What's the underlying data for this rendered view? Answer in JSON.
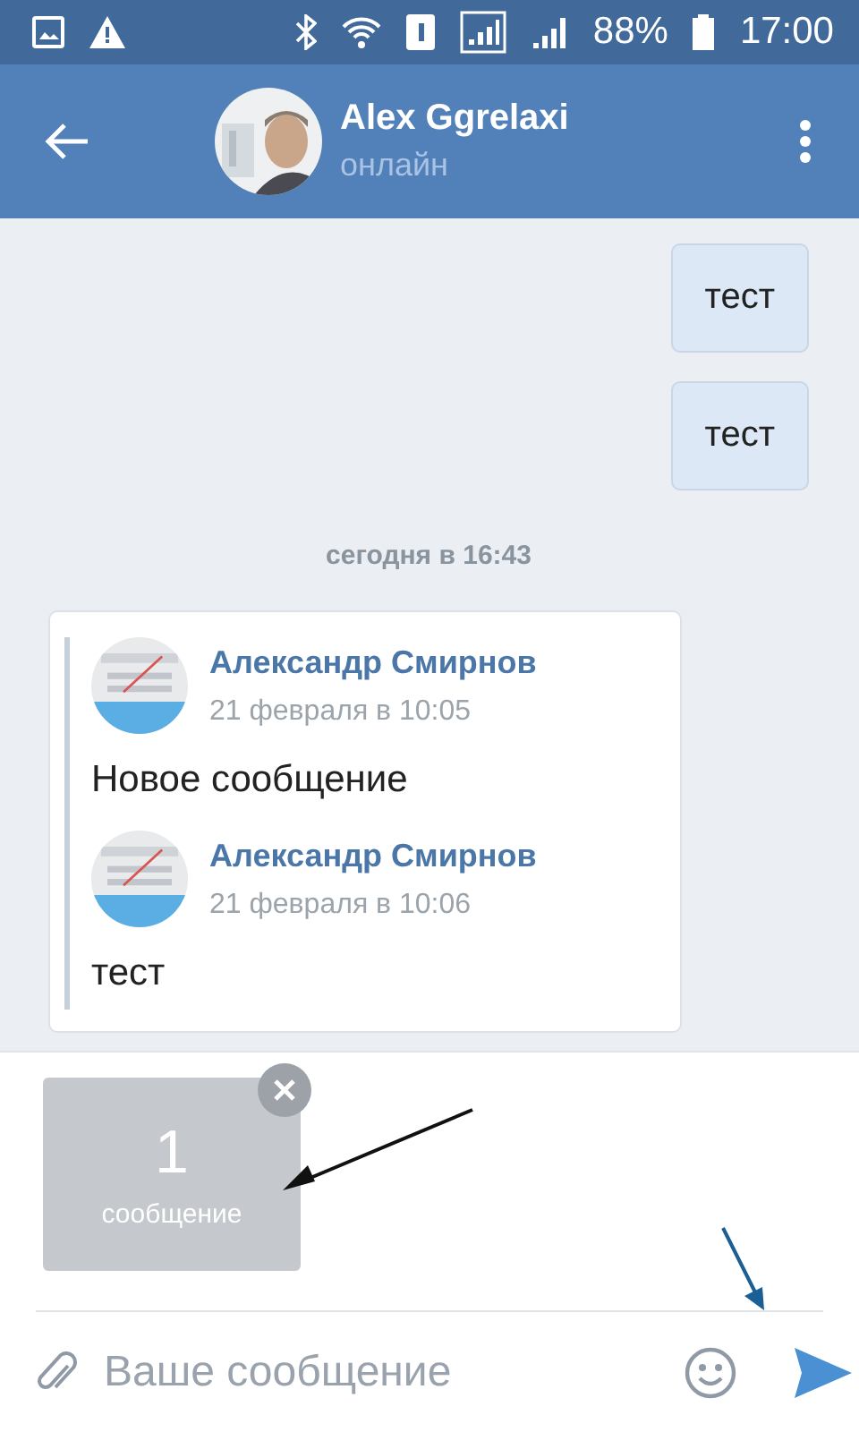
{
  "status_bar": {
    "battery": "88%",
    "time": "17:00"
  },
  "header": {
    "name": "Alex Ggrelaxi",
    "status": "онлайн"
  },
  "messages": [
    {
      "kind": "outgoing",
      "text": "тест"
    },
    {
      "kind": "outgoing",
      "text": "тест"
    },
    {
      "kind": "date",
      "text": "сегодня в 16:43"
    },
    {
      "kind": "forwarded",
      "items": [
        {
          "author": "Александр Смирнов",
          "date": "21 февраля в 10:05",
          "text": "Новое сообщение"
        },
        {
          "author": "Александр Смирнов",
          "date": "21 февраля в 10:06",
          "text": "тест"
        }
      ]
    }
  ],
  "attachment": {
    "count": "1",
    "label": "сообщение"
  },
  "composer": {
    "placeholder": "Ваше сообщение"
  }
}
